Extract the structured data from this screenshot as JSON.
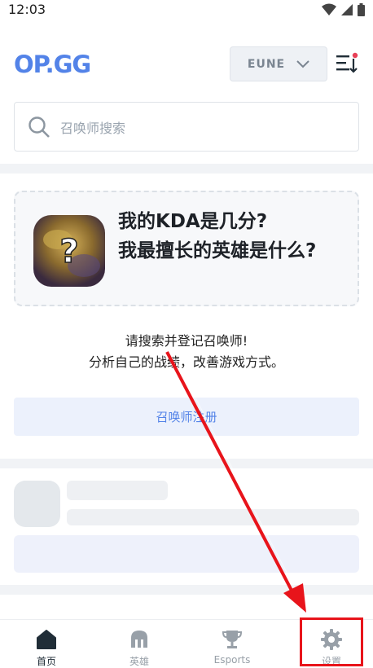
{
  "status_bar": {
    "time": "12:03"
  },
  "header": {
    "logo_text": "OP.GG",
    "region": "EUNE"
  },
  "search": {
    "placeholder": "召唤师搜索"
  },
  "kda_card": {
    "title": "我的KDA是几分?\n我最擅长的英雄是什么?"
  },
  "prompt": {
    "line1": "请搜索并登记召唤师!",
    "line2": "分析自己的战绩，改善游戏方式。"
  },
  "register_button": {
    "label": "召唤师注册"
  },
  "bottom_nav": {
    "items": [
      {
        "label": "首页",
        "icon": "home-icon"
      },
      {
        "label": "英雄",
        "icon": "champion-helmet-icon"
      },
      {
        "label": "Esports",
        "icon": "trophy-icon"
      },
      {
        "label": "设置",
        "icon": "gear-icon"
      }
    ]
  },
  "colors": {
    "brand": "#5383e8",
    "highlight": "#e8141b"
  }
}
